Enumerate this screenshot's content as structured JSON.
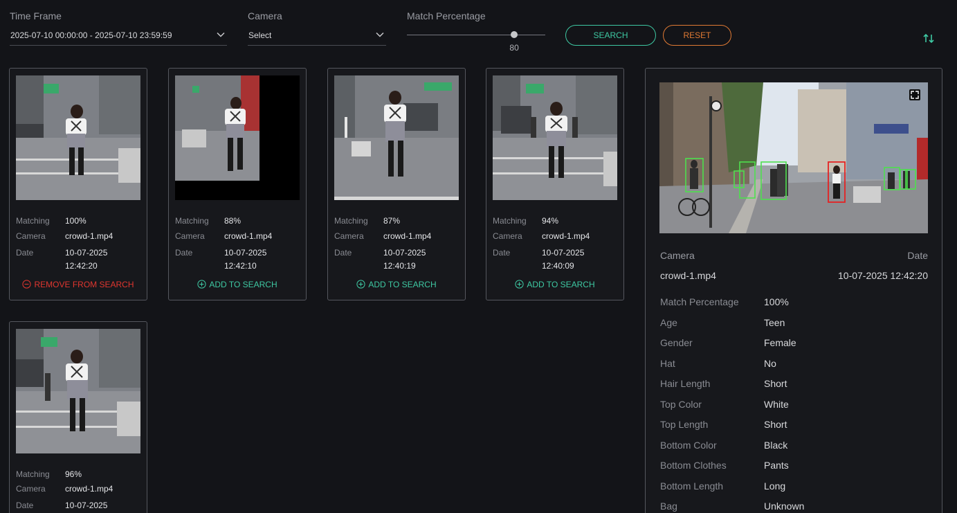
{
  "filters": {
    "time_frame": {
      "label": "Time Frame",
      "value": "2025-07-10 00:00:00 - 2025-07-10 23:59:59"
    },
    "camera": {
      "label": "Camera",
      "value": "Select"
    },
    "match_percentage": {
      "label": "Match Percentage",
      "value": "80",
      "level": 0.8
    },
    "search_label": "SEARCH",
    "reset_label": "RESET",
    "sort_icon": "sort-arrows-icon"
  },
  "results": [
    {
      "matching_label": "Matching",
      "matching": "100%",
      "camera_label": "Camera",
      "camera": "crowd-1.mp4",
      "date_label": "Date",
      "date": "10-07-2025",
      "time": "12:42:20",
      "action": "REMOVE FROM SEARCH",
      "action_type": "remove"
    },
    {
      "matching_label": "Matching",
      "matching": "88%",
      "camera_label": "Camera",
      "camera": "crowd-1.mp4",
      "date_label": "Date",
      "date": "10-07-2025",
      "time": "12:42:10",
      "action": "ADD TO SEARCH",
      "action_type": "add"
    },
    {
      "matching_label": "Matching",
      "matching": "87%",
      "camera_label": "Camera",
      "camera": "crowd-1.mp4",
      "date_label": "Date",
      "date": "10-07-2025",
      "time": "12:40:19",
      "action": "ADD TO SEARCH",
      "action_type": "add"
    },
    {
      "matching_label": "Matching",
      "matching": "94%",
      "camera_label": "Camera",
      "camera": "crowd-1.mp4",
      "date_label": "Date",
      "date": "10-07-2025",
      "time": "12:40:09",
      "action": "ADD TO SEARCH",
      "action_type": "add"
    },
    {
      "matching_label": "Matching",
      "matching": "96%",
      "camera_label": "Camera",
      "camera": "crowd-1.mp4",
      "date_label": "Date",
      "date": "10-07-2025"
    }
  ],
  "detail": {
    "camera_label": "Camera",
    "camera": "crowd-1.mp4",
    "date_label": "Date",
    "date": "10-07-2025 12:42:20",
    "attributes": [
      {
        "label": "Match Percentage",
        "value": "100%"
      },
      {
        "label": "Age",
        "value": "Teen"
      },
      {
        "label": "Gender",
        "value": "Female"
      },
      {
        "label": "Hat",
        "value": "No"
      },
      {
        "label": "Hair Length",
        "value": "Short"
      },
      {
        "label": "Top Color",
        "value": "White"
      },
      {
        "label": "Top Length",
        "value": "Short"
      },
      {
        "label": "Bottom Color",
        "value": "Black"
      },
      {
        "label": "Bottom Clothes",
        "value": "Pants"
      },
      {
        "label": "Bottom Length",
        "value": "Long"
      },
      {
        "label": "Bag",
        "value": "Unknown"
      }
    ]
  },
  "colors": {
    "accent_green": "#3ec9a3",
    "accent_orange": "#e07a34",
    "remove_red": "#e0362f",
    "detection_green": "#4ee04e",
    "detection_red": "#e52222"
  }
}
